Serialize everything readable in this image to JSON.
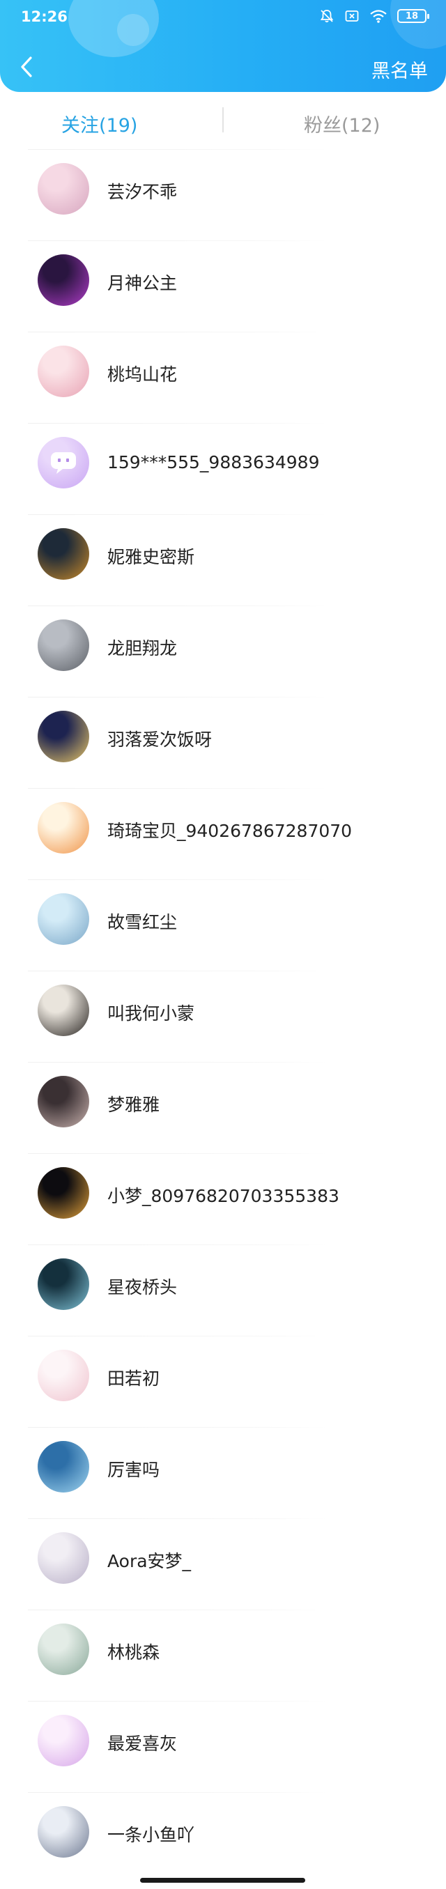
{
  "status_bar": {
    "time": "12:26",
    "battery": "18"
  },
  "header": {
    "blacklist_label": "黑名单"
  },
  "tabs": {
    "following_label": "关注(19)",
    "fans_label": "粉丝(12)"
  },
  "users": [
    {
      "name": "芸汐不乖",
      "avatar_colors": [
        "#f6d9e4",
        "#d7a6bf"
      ]
    },
    {
      "name": "月神公主",
      "avatar_colors": [
        "#2a1540",
        "#b03cc8"
      ]
    },
    {
      "name": "桃坞山花",
      "avatar_colors": [
        "#fbe3e7",
        "#e8a3b4"
      ]
    },
    {
      "name": "159***555_9883634989",
      "avatar_colors": [
        "#e9d8fb",
        "#c9a6f3"
      ]
    },
    {
      "name": "妮雅史密斯",
      "avatar_colors": [
        "#1e2a38",
        "#c98a2a"
      ]
    },
    {
      "name": "龙胆翔龙",
      "avatar_colors": [
        "#b8bcc3",
        "#5d6168"
      ]
    },
    {
      "name": "羽落爱次饭呀",
      "avatar_colors": [
        "#1d2350",
        "#e8c767"
      ]
    },
    {
      "name": "琦琦宝贝_940267867287070",
      "avatar_colors": [
        "#fff4e0",
        "#f0954a"
      ]
    },
    {
      "name": "故雪红尘",
      "avatar_colors": [
        "#d3ebf7",
        "#7aa7c8"
      ]
    },
    {
      "name": "叫我何小蒙",
      "avatar_colors": [
        "#e9e4dc",
        "#2a2623"
      ]
    },
    {
      "name": "梦雅雅",
      "avatar_colors": [
        "#3a3033",
        "#c9b2ae"
      ]
    },
    {
      "name": "小梦_80976820703355383",
      "avatar_colors": [
        "#0d0c10",
        "#e0a03a"
      ]
    },
    {
      "name": "星夜桥头",
      "avatar_colors": [
        "#14303d",
        "#7fc2d6"
      ]
    },
    {
      "name": "田若初",
      "avatar_colors": [
        "#fdf5f7",
        "#f0c4cf"
      ]
    },
    {
      "name": "厉害吗",
      "avatar_colors": [
        "#2d6fa8",
        "#9fd4ef"
      ]
    },
    {
      "name": "Aora安梦_",
      "avatar_colors": [
        "#f1eef4",
        "#b9b0c8"
      ]
    },
    {
      "name": "林桃森",
      "avatar_colors": [
        "#e3ece6",
        "#8aa99a"
      ]
    },
    {
      "name": "最爱喜灰",
      "avatar_colors": [
        "#fbeefc",
        "#d7a7e9"
      ]
    },
    {
      "name": "一条小鱼吖",
      "avatar_colors": [
        "#e9edf4",
        "#6f7a92"
      ]
    }
  ]
}
